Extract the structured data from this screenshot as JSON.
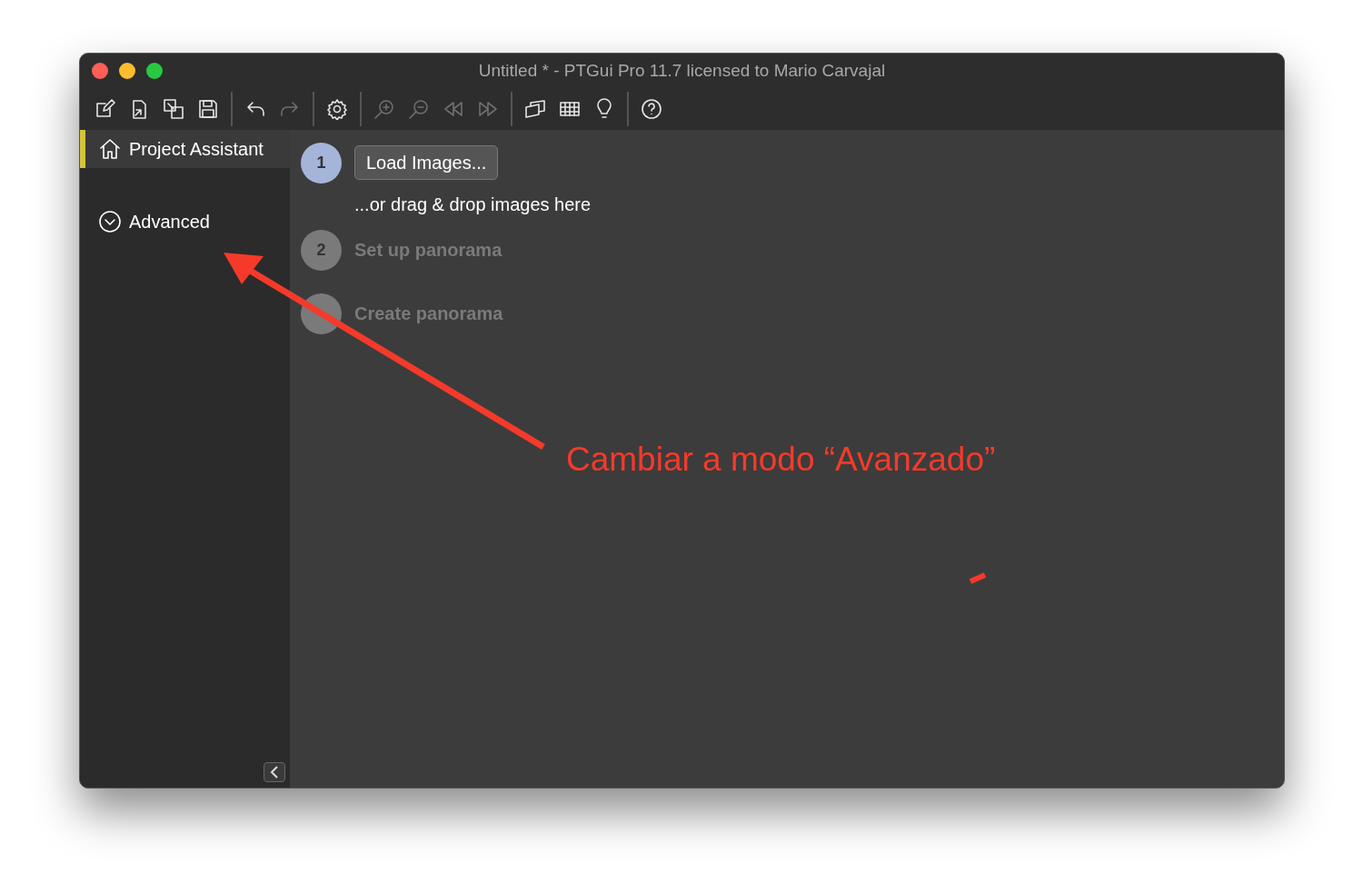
{
  "window": {
    "title": "Untitled * - PTGui Pro 11.7 licensed to Mario Carvajal"
  },
  "toolbar": [
    [
      {
        "kind": "new",
        "disabled": false
      },
      {
        "kind": "import",
        "disabled": false
      },
      {
        "kind": "merge",
        "disabled": false
      },
      {
        "kind": "save",
        "disabled": false
      }
    ],
    [
      {
        "kind": "undo",
        "disabled": false
      },
      {
        "kind": "redo",
        "disabled": true
      }
    ],
    [
      {
        "kind": "settings",
        "disabled": false
      }
    ],
    [
      {
        "kind": "zoom-in",
        "disabled": true
      },
      {
        "kind": "zoom-out",
        "disabled": true
      },
      {
        "kind": "rewind",
        "disabled": true
      },
      {
        "kind": "forward",
        "disabled": true
      }
    ],
    [
      {
        "kind": "panorama",
        "disabled": false
      },
      {
        "kind": "grid",
        "disabled": false
      },
      {
        "kind": "bulb",
        "disabled": false
      }
    ],
    [
      {
        "kind": "help",
        "disabled": false
      }
    ]
  ],
  "sidebar": {
    "items": [
      {
        "kind": "home",
        "label": "Project Assistant",
        "selected": true
      },
      {
        "kind": "chevron",
        "label": "Advanced",
        "selected": false
      }
    ]
  },
  "steps": [
    {
      "number": "1",
      "active": true,
      "button": "Load Images...",
      "hint": "...or drag & drop images here"
    },
    {
      "number": "2",
      "active": false,
      "label": "Set up panorama"
    },
    {
      "active": false,
      "label": "Create panorama"
    }
  ],
  "annotation": {
    "text": "Cambiar a modo “Avanzado”"
  }
}
